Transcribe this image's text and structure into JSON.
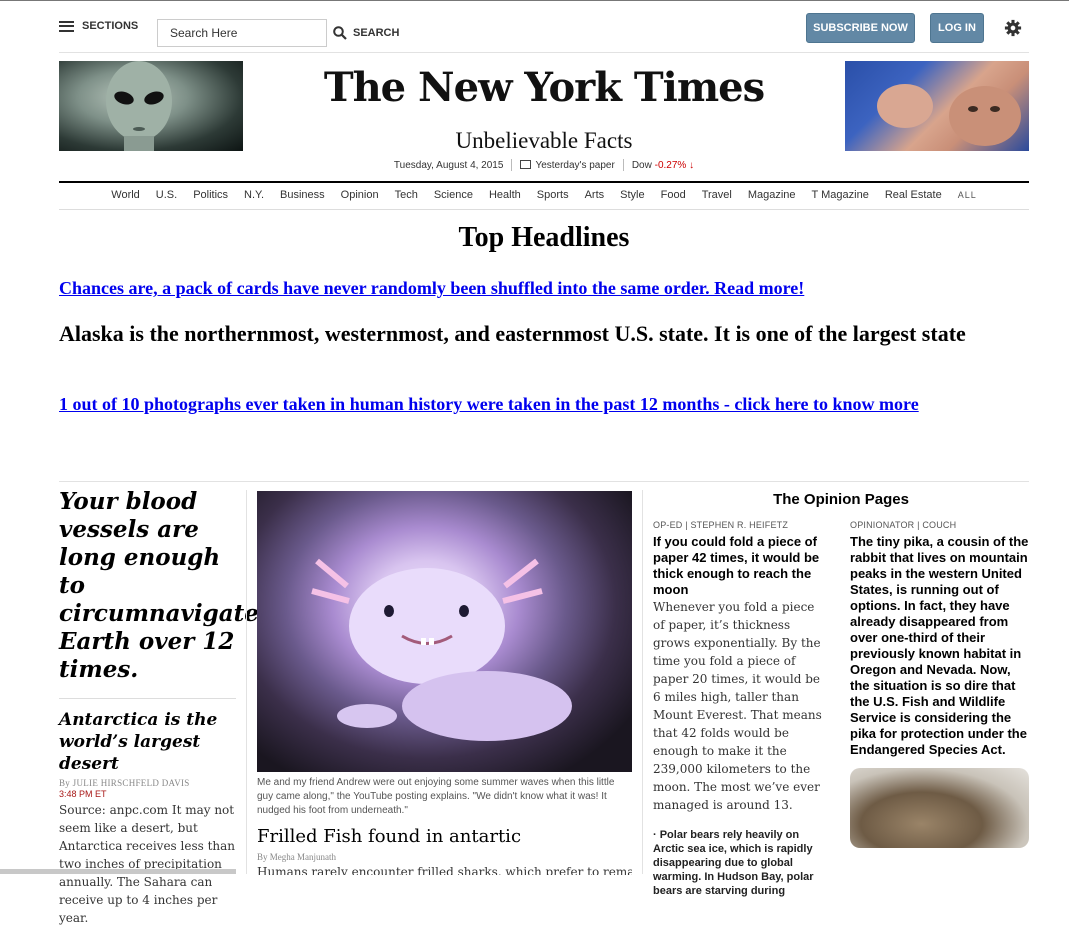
{
  "topbar": {
    "sections_label": "SECTIONS",
    "search_placeholder": "Search Here",
    "search_label": "SEARCH",
    "subscribe_label": "SUBSCRIBE NOW",
    "login_label": "LOG IN"
  },
  "masthead": {
    "logo": "The New York Times",
    "subtitle": "Unbelievable Facts",
    "date": "Tuesday, August 4, 2015",
    "paper_link": "Yesterday's paper",
    "dow": "Dow ",
    "dow_change": "-0.27% ↓"
  },
  "nav": {
    "items": [
      "World",
      "U.S.",
      "Politics",
      "N.Y.",
      "Business",
      "Opinion",
      "Tech",
      "Science",
      "Health",
      "Sports",
      "Arts",
      "Style",
      "Food",
      "Travel",
      "Magazine",
      "T Magazine",
      "Real Estate"
    ],
    "all": "ALL"
  },
  "headlines": {
    "title": "Top Headlines",
    "link1": "Chances are, a pack of cards have never randomly been shuffled into the same order. Read more!",
    "fact1": "Alaska is the northernmost, westernmost, and easternmost U.S. state. It is one of the largest state",
    "link2": "1 out of 10 photographs ever taken in human history were taken in the past 12 months - click here to know more"
  },
  "col1": {
    "big_headline": "Your blood vessels are long enough to circumnavigate Earth over 12 times.",
    "story_headline": "Antarctica is the world’s largest desert",
    "byline": "By JULIE HIRSCHFELD DAVIS",
    "time": "3:48 PM ET",
    "body": "Source: anpc.com It may not seem like a desert, but Antarctica receives less than two inches of precipitation annually. The Sahara can receive up to 4 inches per year."
  },
  "col2": {
    "caption": "Me and my friend Andrew were out enjoying some summer waves when this little guy came along,\" the YouTube posting explains. \"We didn't know what it was! It nudged his foot from underneath.\"",
    "headline": "Frilled Fish found in antartic",
    "byline": "By Megha Manjunath",
    "body_cut": "Humans rarely encounter frilled sharks, which prefer to remain"
  },
  "opinion": {
    "title": "The Opinion Pages",
    "left": {
      "kicker": "OP-ED | STEPHEN R. HEIFETZ",
      "headline": "If you could fold a piece of paper 42 times, it would be thick enough to reach the moon",
      "body": "Whenever you fold a piece of paper, it’s thickness grows exponentially. By the time you fold a piece of paper 20 times, it would be 6 miles high, taller than Mount Everest. That means that 42 folds would be enough to make it the 239,000 kilometers to the moon. The most we’ve ever managed is around 13.",
      "bullet": "· Polar bears rely heavily on Arctic sea ice, which is rapidly disappearing due to global warming. In Hudson Bay, polar bears are starving during"
    },
    "right": {
      "kicker": "OPINIONATOR | COUCH",
      "headline": "The tiny pika, a cousin of the rabbit that lives on mountain peaks in the western United States, is running out of options. In fact, they have already disappeared from over one-third of their previously known habitat in Oregon and Nevada. Now, the situation is so dire that the U.S. Fish and Wildlife Service is considering the pika for protection under the Endangered Species Act."
    }
  }
}
